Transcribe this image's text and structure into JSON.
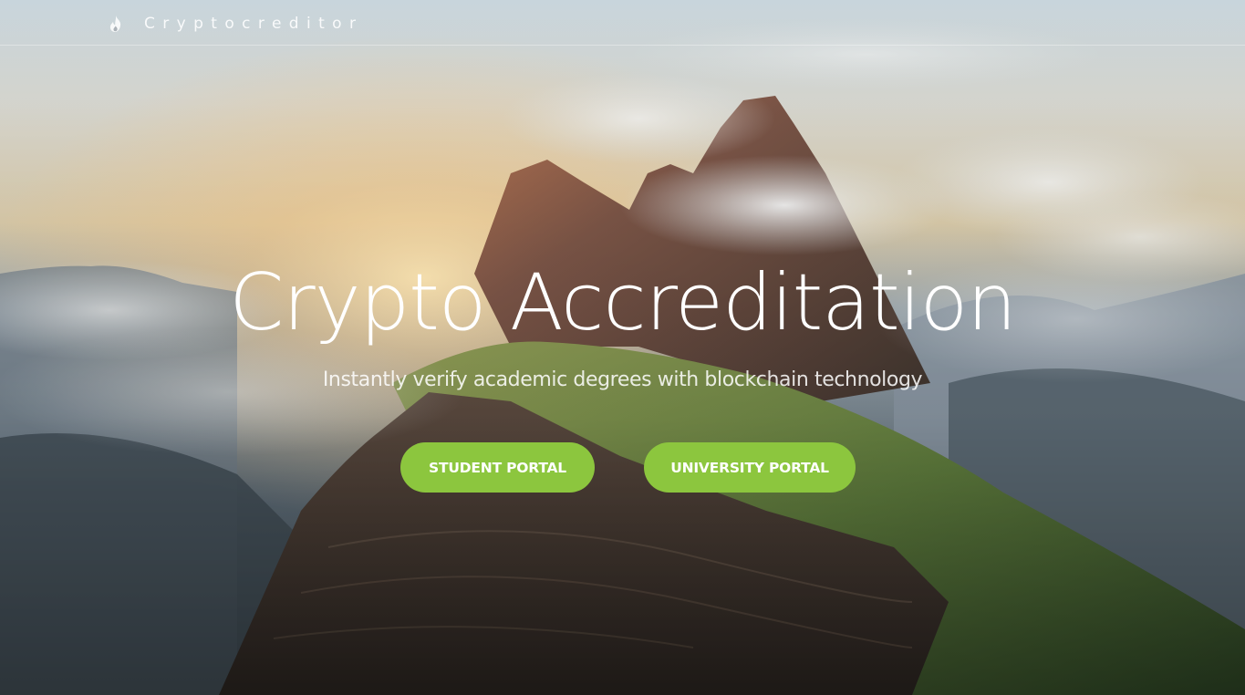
{
  "navbar": {
    "brand_name": "Cryptocreditor",
    "brand_icon": "flame-icon"
  },
  "hero": {
    "title": "Crypto Accreditation",
    "subtitle": "Instantly verify academic degrees with blockchain technology",
    "background": "mountain-landscape-photo"
  },
  "actions": {
    "student_portal_label": "STUDENT PORTAL",
    "university_portal_label": "UNIVERSITY PORTAL"
  },
  "colors": {
    "accent": "#8cc63e",
    "text": "#ffffff"
  }
}
